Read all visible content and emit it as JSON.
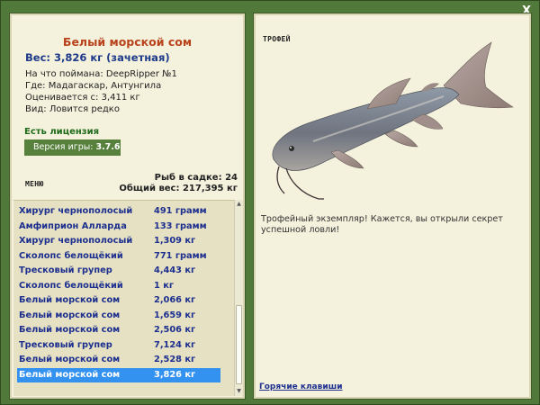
{
  "close_label": "X",
  "fish": {
    "name": "Белый морской сом",
    "weight": "Вес: 3,826 кг (зачетная)",
    "bait": "На что поймана: DeepRipper №1",
    "location": "Где: Мадагаскар, Антунгила",
    "value": "Оценивается с: 3,411 кг",
    "rarity": "Вид: Ловится редко"
  },
  "license": "Есть лицензия",
  "version": {
    "label": "Версия игры:",
    "number": "3.7.6"
  },
  "menu_label": "МЕНЮ",
  "stats": {
    "fish_count": "Рыб в садке: 24",
    "total_weight": "Общий вес: 217,395 кг"
  },
  "catches": [
    {
      "name": "Хирург чернополосый",
      "weight": "491 грамм"
    },
    {
      "name": "Амфиприон Алларда",
      "weight": "133 грамм"
    },
    {
      "name": "Хирург чернополосый",
      "weight": "1,309 кг"
    },
    {
      "name": "Сколопс белощёкий",
      "weight": "771 грамм"
    },
    {
      "name": "Тресковый групер",
      "weight": "4,443 кг"
    },
    {
      "name": "Сколопс белощёкий",
      "weight": "1 кг"
    },
    {
      "name": "Белый морской сом",
      "weight": "2,066 кг"
    },
    {
      "name": "Белый морской сом",
      "weight": "1,659 кг"
    },
    {
      "name": "Белый морской сом",
      "weight": "2,506 кг"
    },
    {
      "name": "Тресковый групер",
      "weight": "7,124 кг"
    },
    {
      "name": "Белый морской сом",
      "weight": "2,528 кг"
    },
    {
      "name": "Белый морской сом",
      "weight": "3,826 кг"
    }
  ],
  "selected_index": 11,
  "trophy": {
    "title": "ТРОФЕЙ",
    "description": "Трофейный экземпляр! Кажется, вы открыли секрет успешной ловли!"
  },
  "hotkeys_label": "Горячие клавиши",
  "colors": {
    "background": "#50793a",
    "panel": "#f4f1dc",
    "list_bg": "#e5e1c2",
    "fish_name": "#b8431c",
    "link_blue": "#1d2f8f",
    "selection": "#3391ef",
    "license_green": "#1f6b1a"
  }
}
